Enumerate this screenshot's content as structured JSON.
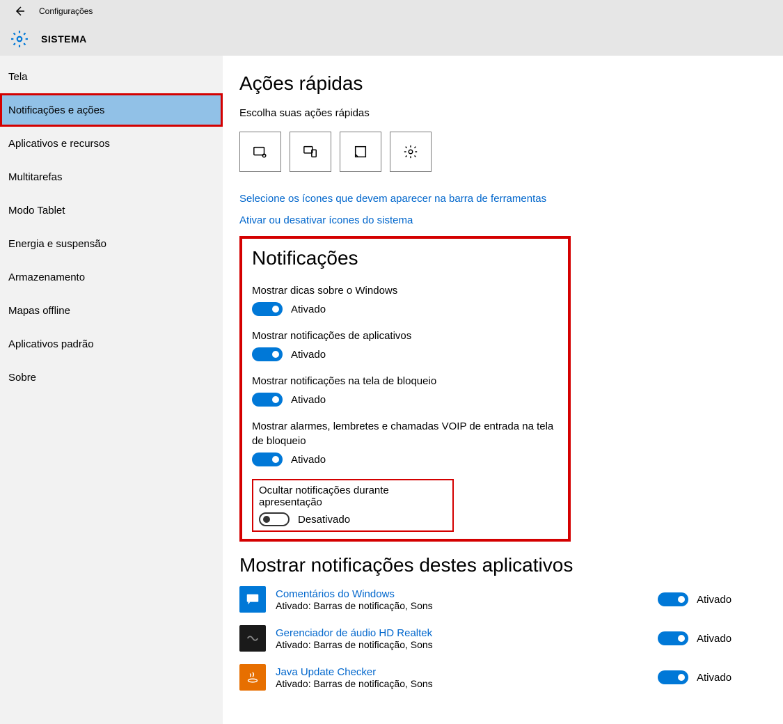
{
  "titlebar": {
    "title": "Configurações"
  },
  "header": {
    "section": "SISTEMA"
  },
  "sidebar": {
    "items": [
      {
        "label": "Tela"
      },
      {
        "label": "Notificações e ações"
      },
      {
        "label": "Aplicativos e recursos"
      },
      {
        "label": "Multitarefas"
      },
      {
        "label": "Modo Tablet"
      },
      {
        "label": "Energia e suspensão"
      },
      {
        "label": "Armazenamento"
      },
      {
        "label": "Mapas offline"
      },
      {
        "label": "Aplicativos padrão"
      },
      {
        "label": "Sobre"
      }
    ]
  },
  "quick_actions": {
    "heading": "Ações rápidas",
    "subtext": "Escolha suas ações rápidas",
    "link1": "Selecione os ícones que devem aparecer na barra de ferramentas",
    "link2": "Ativar ou desativar ícones do sistema"
  },
  "notifications": {
    "heading": "Notificações",
    "on_label": "Ativado",
    "off_label": "Desativado",
    "items": [
      {
        "label": "Mostrar dicas sobre o Windows",
        "state": "Ativado"
      },
      {
        "label": "Mostrar notificações de aplicativos",
        "state": "Ativado"
      },
      {
        "label": "Mostrar notificações na tela de bloqueio",
        "state": "Ativado"
      },
      {
        "label": "Mostrar alarmes, lembretes e chamadas VOIP de entrada na tela de bloqueio",
        "state": "Ativado"
      }
    ],
    "hide_box": {
      "label": "Ocultar notificações durante apresentação",
      "state": "Desativado"
    }
  },
  "app_notifications": {
    "heading": "Mostrar notificações destes aplicativos",
    "apps": [
      {
        "name": "Comentários do Windows",
        "sub": "Ativado: Barras de notificação, Sons",
        "state": "Ativado"
      },
      {
        "name": "Gerenciador de áudio HD Realtek",
        "sub": "Ativado: Barras de notificação, Sons",
        "state": "Ativado"
      },
      {
        "name": "Java Update Checker",
        "sub": "Ativado: Barras de notificação, Sons",
        "state": "Ativado"
      }
    ]
  }
}
